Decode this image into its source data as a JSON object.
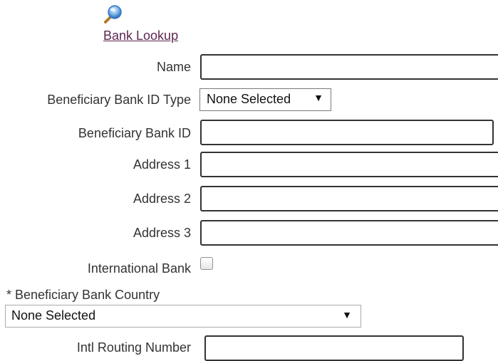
{
  "bank_lookup": {
    "icon": "magnifier-icon",
    "link_label": "Bank Lookup"
  },
  "fields": {
    "name_label": "Name",
    "name_value": "",
    "bank_id_type_label": "Beneficiary Bank ID Type",
    "bank_id_type_value": "None Selected",
    "bank_id_label": "Beneficiary Bank ID",
    "bank_id_value": "",
    "address1_label": "Address 1",
    "address1_value": "",
    "address2_label": "Address 2",
    "address2_value": "",
    "address3_label": "Address 3",
    "address3_value": "",
    "international_bank_label": "International Bank",
    "international_bank_checked": false,
    "country_label": "* Beneficiary Bank Country",
    "country_value": "None Selected",
    "intl_routing_label": "Intl Routing Number",
    "intl_routing_value": ""
  },
  "dropdown_arrow": "▼",
  "colors": {
    "link": "#5e2750",
    "label_text": "#333333",
    "input_border": "#333333",
    "select_border": "#7a7a7a"
  }
}
